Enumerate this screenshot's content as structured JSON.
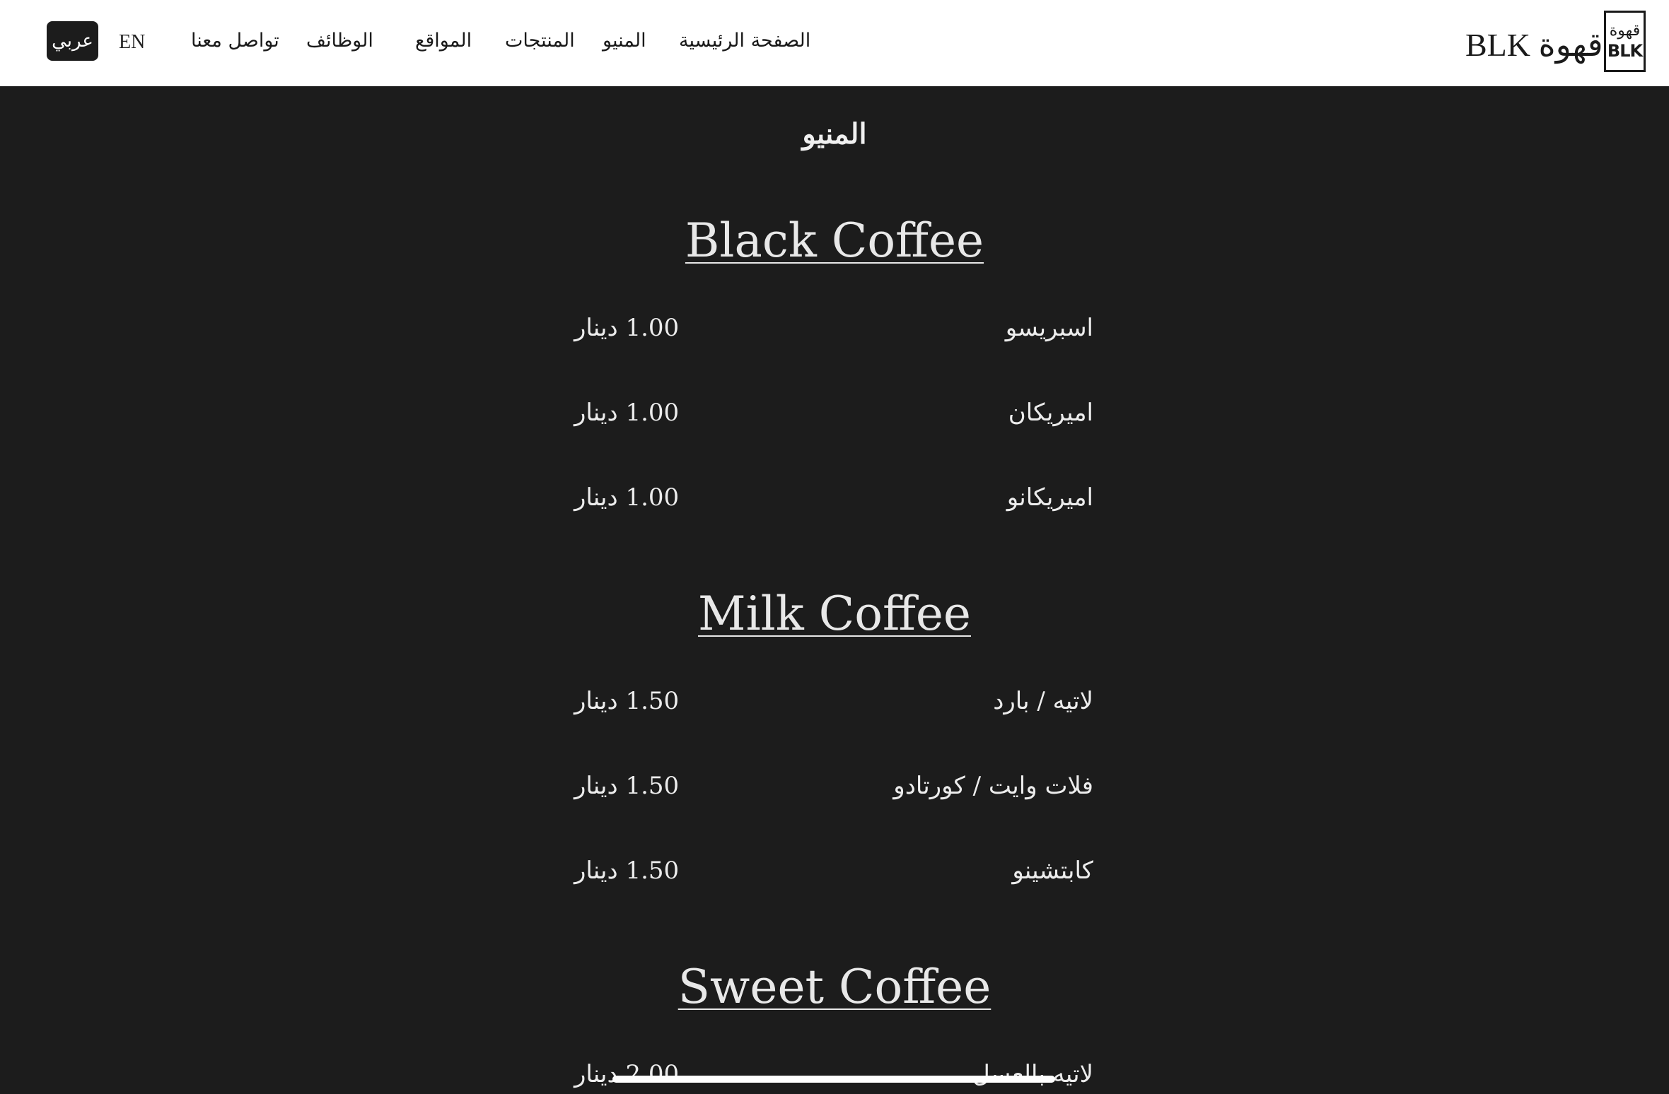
{
  "header": {
    "lang_ar": "عربي",
    "lang_en": "EN",
    "nav": [
      "تواصل معنا",
      "الوظائف",
      "المواقع",
      "المنتجات",
      "المنيو",
      "الصفحة الرئيسية"
    ],
    "brand_text": "BLK قهوة",
    "logo_line1": "قهوة",
    "logo_line2": "BLK"
  },
  "page_title": "المنيو",
  "sections": [
    {
      "title": "Black Coffee",
      "items": [
        {
          "name": "اسبريسو",
          "price": "1.00 دينار"
        },
        {
          "name": "اميريكان",
          "price": "1.00 دينار"
        },
        {
          "name": "اميريكانو",
          "price": "1.00 دينار"
        }
      ]
    },
    {
      "title": "Milk Coffee",
      "items": [
        {
          "name": "لاتيه / بارد",
          "price": "1.50 دينار"
        },
        {
          "name": "فلات وايت / كورتادو",
          "price": "1.50 دينار"
        },
        {
          "name": "كابتشينو",
          "price": "1.50 دينار"
        }
      ]
    },
    {
      "title": "Sweet Coffee",
      "items": [
        {
          "name": "لاتيه بالعسل",
          "price": "2.00 دينار"
        }
      ]
    }
  ],
  "colors": {
    "background": "#1c1c1c",
    "header": "#ffffff",
    "text": "#e9e9e9"
  }
}
